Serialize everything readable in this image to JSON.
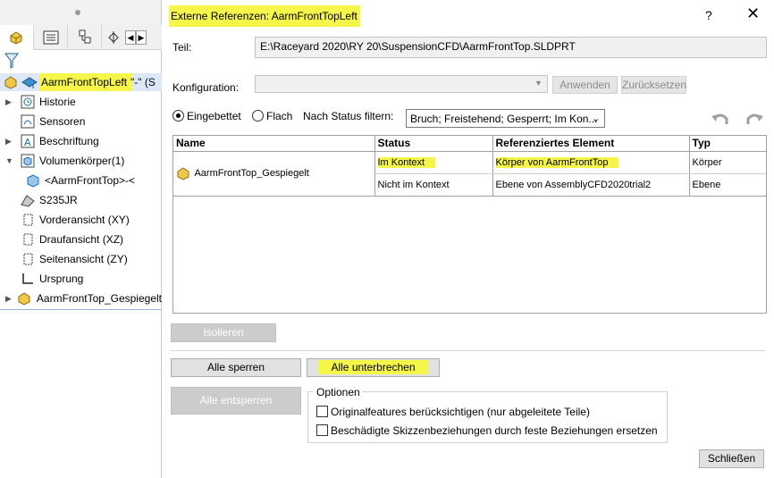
{
  "tree": {
    "root_label": "AarmFrontTopLeft",
    "root_suffix": "\"-\"  (S",
    "items": [
      {
        "label": "Historie",
        "icon": "history-icon",
        "expandable": true
      },
      {
        "label": "Sensoren",
        "icon": "sensor-icon",
        "expandable": false
      },
      {
        "label": "Beschriftung",
        "icon": "annotation-icon",
        "expandable": true
      },
      {
        "label": "Volumenkörper(1)",
        "icon": "solid-bodies-icon",
        "expandable": true
      },
      {
        "label": "<AarmFrontTop>-<",
        "icon": "body-icon",
        "expandable": false
      },
      {
        "label": "S235JR",
        "icon": "material-icon",
        "expandable": false
      },
      {
        "label": "Vorderansicht (XY)",
        "icon": "plane-icon",
        "expandable": false
      },
      {
        "label": "Draufansicht (XZ)",
        "icon": "plane-icon",
        "expandable": false
      },
      {
        "label": "Seitenansicht (ZY)",
        "icon": "plane-icon",
        "expandable": false
      },
      {
        "label": "Ursprung",
        "icon": "origin-icon",
        "expandable": false
      },
      {
        "label": "AarmFrontTop_Gespiegelt",
        "icon": "part-icon",
        "expandable": true
      }
    ]
  },
  "dialog": {
    "title": "Externe Referenzen: AarmFrontTopLeft",
    "help": "?",
    "close": "✕",
    "teil_label": "Teil:",
    "teil_value": "E:\\Raceyard 2020\\RY 20\\SuspensionCFD\\AarmFrontTop.SLDPRT",
    "config_label": "Konfiguration:",
    "config_value": "",
    "apply": "Anwenden",
    "reset": "Zurücksetzen",
    "radio_embedded": "Eingebettet",
    "radio_flat": "Flach",
    "filter_label": "Nach Status filtern:",
    "filter_value": "Bruch; Freistehend; Gesperrt; Im Kon...",
    "table": {
      "headers": [
        "Name",
        "Status",
        "Referenziertes Element",
        "Typ"
      ],
      "part_name": "AarmFrontTop_Gespiegelt",
      "rows": [
        {
          "status": "Im Kontext",
          "element": "Körper von AarmFrontTop",
          "typ": "Körper"
        },
        {
          "status": "Nicht im Kontext",
          "element": "Ebene von AssemblyCFD2020trial2",
          "typ": "Ebene"
        }
      ]
    },
    "isolate": "Isolieren",
    "lock_all": "Alle sperren",
    "break_all": "Alle unterbrechen",
    "unlock_all": "Alle entsperren",
    "options_legend": "Optionen",
    "opt1": "Originalfeatures berücksichtigen (nur abgeleitete Teile)",
    "opt2": "Beschädigte Skizzenbeziehungen durch feste Beziehungen ersetzen",
    "close_button": "Schließen"
  },
  "colors": {
    "highlight": "#f5f54a",
    "selection": "#dce8f5"
  }
}
